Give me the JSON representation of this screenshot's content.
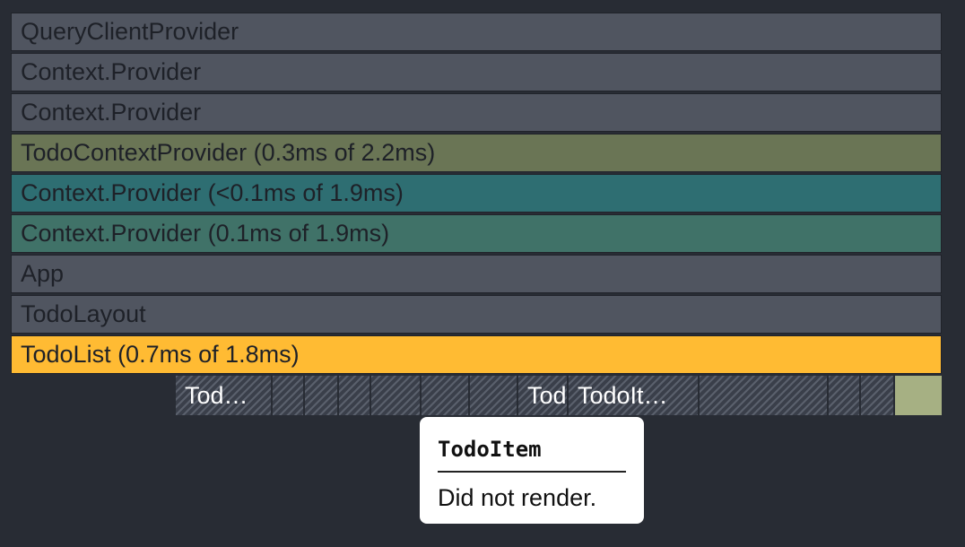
{
  "flamegraph": {
    "rows": [
      {
        "label": "QueryClientProvider",
        "color": "#505560"
      },
      {
        "label": "Context.Provider",
        "color": "#505560"
      },
      {
        "label": "Context.Provider",
        "color": "#505560"
      },
      {
        "label": "TodoContextProvider (0.3ms of 2.2ms)",
        "color": "#6a7555"
      },
      {
        "label": "Context.Provider (<0.1ms of 1.9ms)",
        "color": "#2e6e72"
      },
      {
        "label": "Context.Provider (0.1ms of 1.9ms)",
        "color": "#407268"
      },
      {
        "label": "App",
        "color": "#505560"
      },
      {
        "label": "TodoLayout",
        "color": "#505560"
      },
      {
        "label": "TodoList (0.7ms of 1.8ms)",
        "color": "#ffbb33"
      }
    ],
    "children": [
      {
        "label": "Tod…"
      },
      {
        "label": ""
      },
      {
        "label": ""
      },
      {
        "label": ""
      },
      {
        "label": ""
      },
      {
        "label": ""
      },
      {
        "label": ""
      },
      {
        "label": "TodoIt…"
      },
      {
        "label": "TodoIt…"
      },
      {
        "label": ""
      },
      {
        "label": ""
      },
      {
        "label": ""
      }
    ]
  },
  "tooltip": {
    "title": "TodoItem",
    "message": "Did not render."
  }
}
